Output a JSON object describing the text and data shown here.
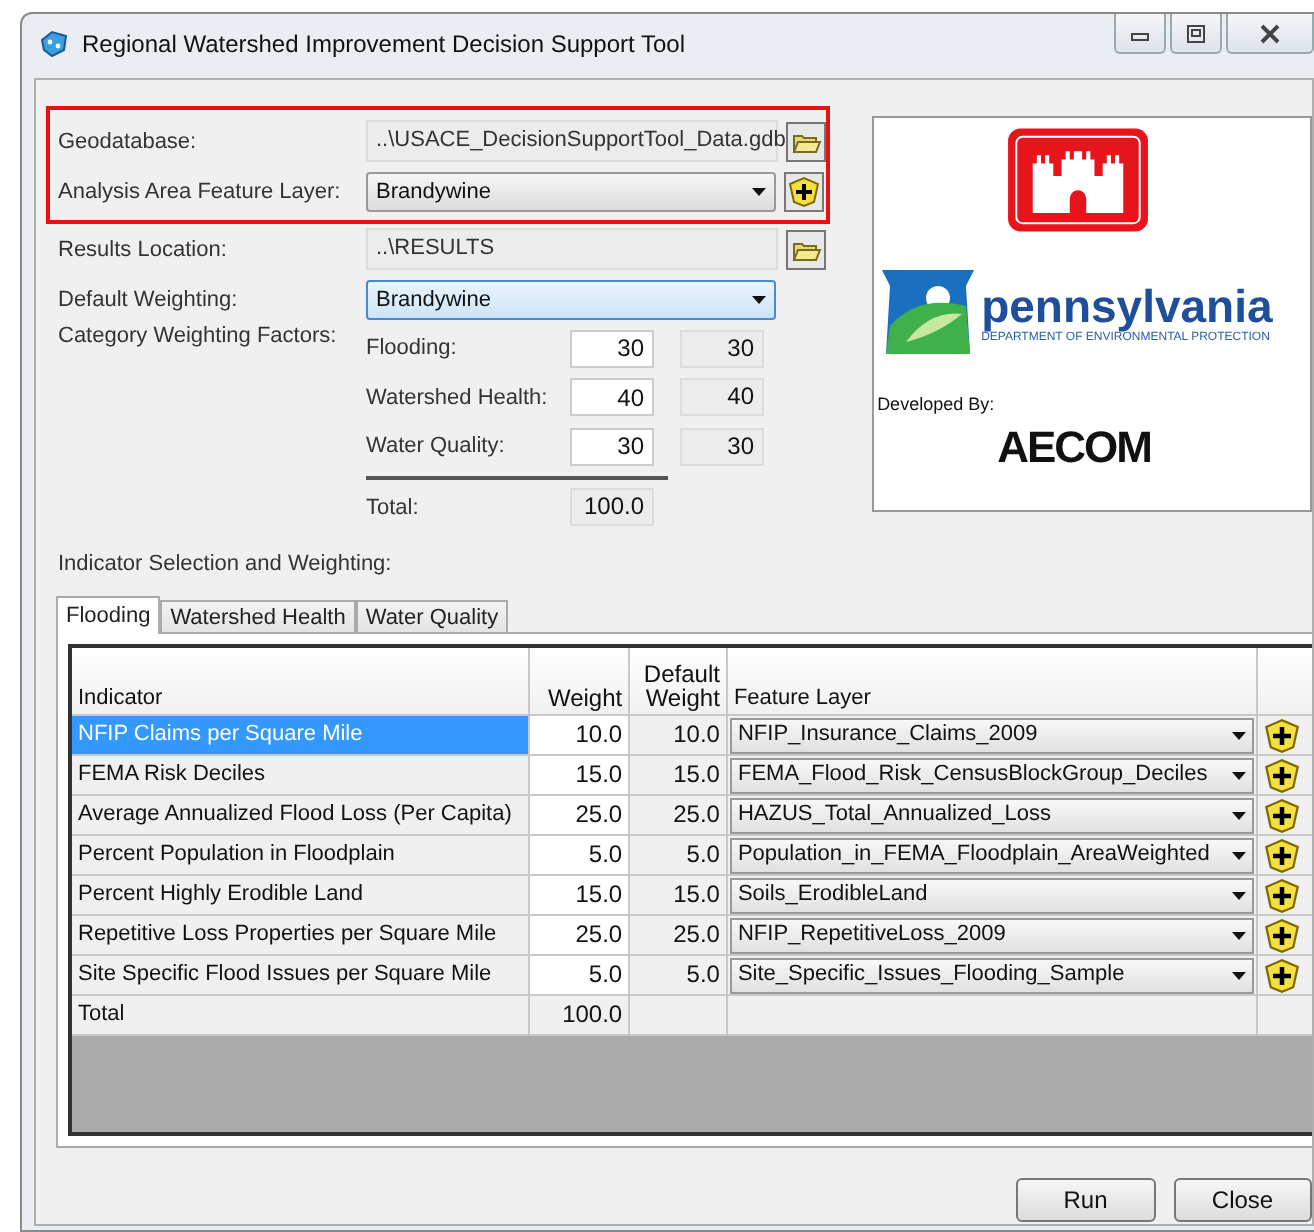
{
  "window": {
    "title": "Regional Watershed Improvement Decision Support Tool"
  },
  "settings": {
    "geodatabase": {
      "label": "Geodatabase:",
      "value": "..\\USACE_DecisionSupportTool_Data.gdb"
    },
    "analysis_area": {
      "label": "Analysis Area Feature Layer:",
      "value": "Brandywine"
    },
    "results_location": {
      "label": "Results Location:",
      "value": "..\\RESULTS"
    },
    "default_weighting": {
      "label": "Default Weighting:",
      "value": "Brandywine"
    }
  },
  "category_weighting": {
    "label": "Category Weighting Factors:",
    "factors": [
      {
        "name": "Flooding:",
        "value": "30",
        "default": "30"
      },
      {
        "name": "Watershed Health:",
        "value": "40",
        "default": "40"
      },
      {
        "name": "Water Quality:",
        "value": "30",
        "default": "30"
      }
    ],
    "total_label": "Total:",
    "total": "100.0"
  },
  "logos": {
    "agency": "pennsylvania",
    "agency_subtitle": "DEPARTMENT OF ENVIRONMENTAL PROTECTION",
    "developed_by": "Developed By:",
    "developer": "AECOM"
  },
  "indicators": {
    "label": "Indicator Selection and Weighting:",
    "tabs": [
      {
        "label": "Flooding",
        "selected": true
      },
      {
        "label": "Watershed Health",
        "selected": false
      },
      {
        "label": "Water Quality",
        "selected": false
      }
    ],
    "columns": [
      "Indicator",
      "Weight",
      "Default Weight",
      "Feature Layer"
    ],
    "rows": [
      {
        "indicator": "NFIP Claims per Square Mile",
        "weight": "10.0",
        "default_weight": "10.0",
        "feature_layer": "NFIP_Insurance_Claims_2009",
        "selected": true
      },
      {
        "indicator": "FEMA Risk Deciles",
        "weight": "15.0",
        "default_weight": "15.0",
        "feature_layer": "FEMA_Flood_Risk_CensusBlockGroup_Deciles",
        "selected": false
      },
      {
        "indicator": "Average Annualized Flood Loss (Per Capita)",
        "weight": "25.0",
        "default_weight": "25.0",
        "feature_layer": "HAZUS_Total_Annualized_Loss",
        "selected": false
      },
      {
        "indicator": "Percent Population in Floodplain",
        "weight": "5.0",
        "default_weight": "5.0",
        "feature_layer": "Population_in_FEMA_Floodplain_AreaWeighted",
        "selected": false
      },
      {
        "indicator": "Percent Highly Erodible Land",
        "weight": "15.0",
        "default_weight": "15.0",
        "feature_layer": "Soils_ErodibleLand",
        "selected": false
      },
      {
        "indicator": "Repetitive Loss Properties per Square Mile",
        "weight": "25.0",
        "default_weight": "25.0",
        "feature_layer": "NFIP_RepetitiveLoss_2009",
        "selected": false
      },
      {
        "indicator": "Site Specific Flood Issues per Square Mile",
        "weight": "5.0",
        "default_weight": "5.0",
        "feature_layer": "Site_Specific_Issues_Flooding_Sample",
        "selected": false
      }
    ],
    "total": {
      "label": "Total",
      "weight": "100.0"
    }
  },
  "buttons": [
    "Run",
    "Close"
  ]
}
